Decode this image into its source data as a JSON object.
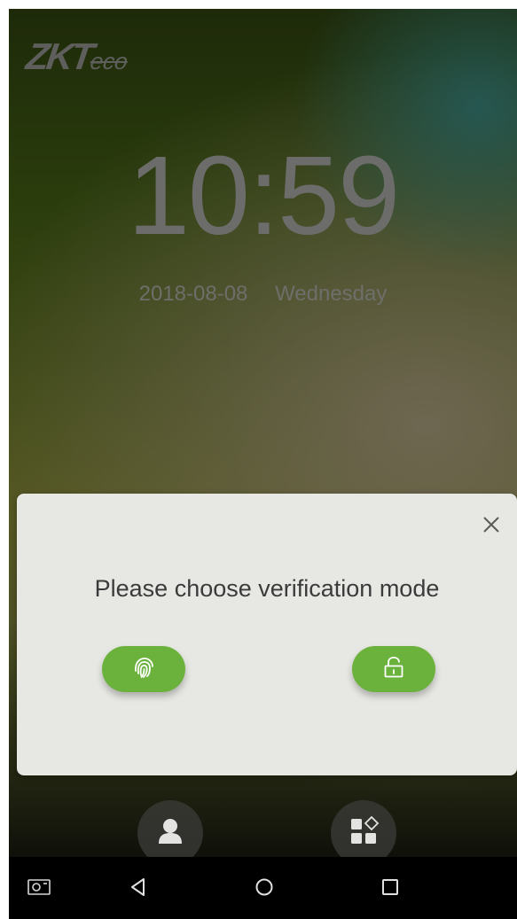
{
  "brand": {
    "logo_main": "ZKT",
    "logo_sub": "eco"
  },
  "clock": {
    "time": "10:59",
    "date": "2018-08-08",
    "weekday": "Wednesday"
  },
  "dialog": {
    "title": "Please choose verification mode",
    "modes": [
      {
        "name": "fingerprint",
        "icon": "fingerprint-icon"
      },
      {
        "name": "password",
        "icon": "lock-icon"
      }
    ],
    "close_icon": "close-icon"
  },
  "dock": {
    "items": [
      "user-icon",
      "menu-icon"
    ]
  },
  "navbar": {
    "items": [
      "screenshot-icon",
      "back-icon",
      "home-icon",
      "recents-icon"
    ]
  },
  "colors": {
    "accent_green": "#6bb23d",
    "dialog_bg": "#e7e8e3",
    "clock_text": "#6c6c6a"
  }
}
